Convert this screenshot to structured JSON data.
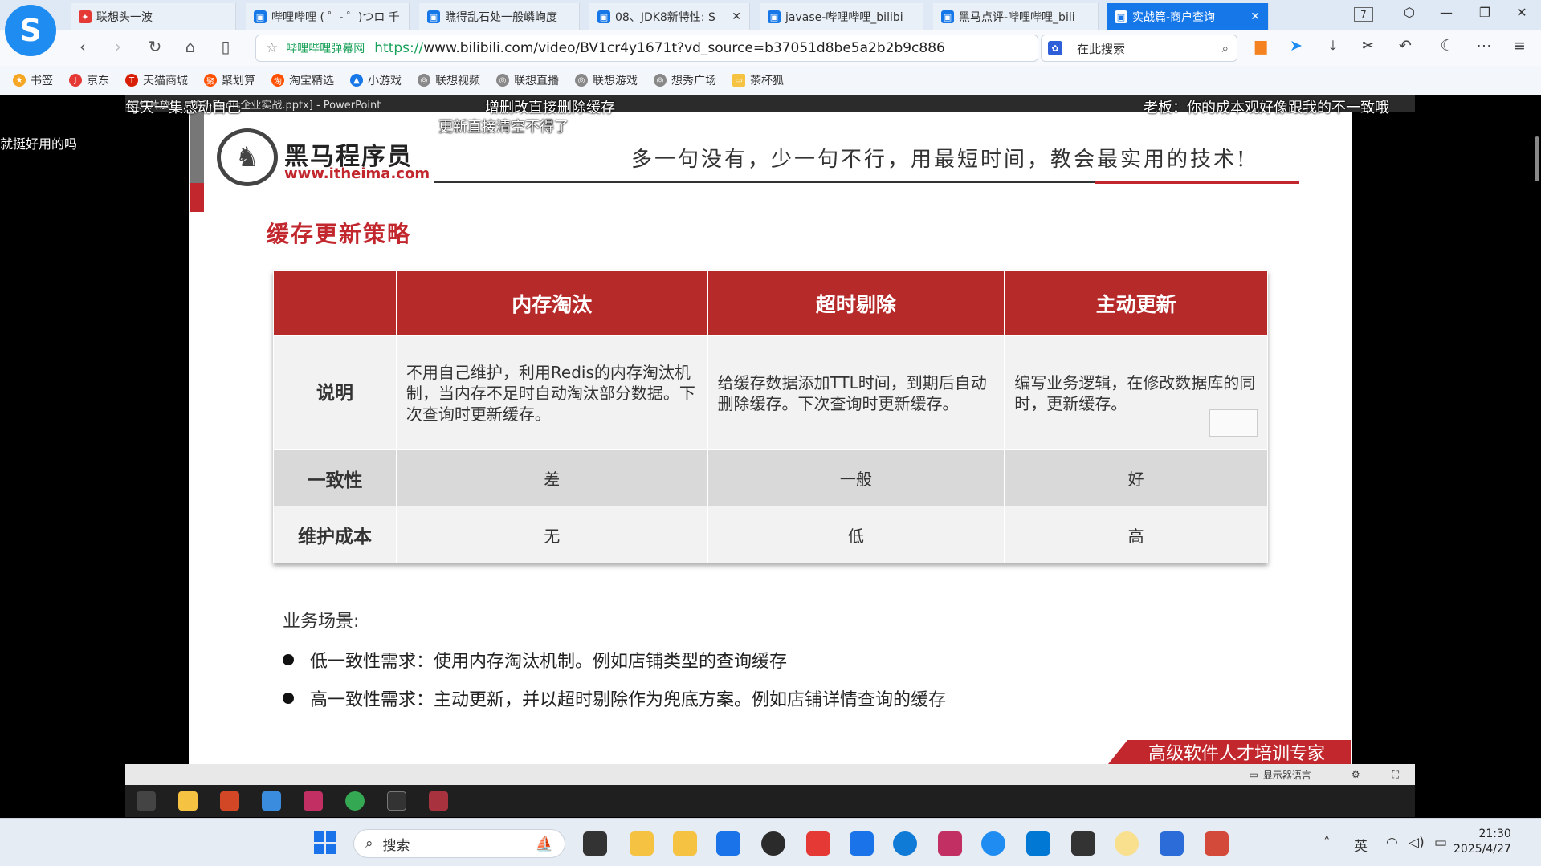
{
  "browser": {
    "tabs": [
      {
        "label": "联想头一波",
        "color": "#e53935",
        "icon": "lenovo-icon"
      },
      {
        "label": "哔哩哔哩 ( ゜- ゜)つロ 千",
        "color": "#1677e8",
        "icon": "bilibili-icon"
      },
      {
        "label": "瞧得乱石处一般嶙峋度",
        "color": "#1677e8",
        "icon": "bilibili-icon"
      },
      {
        "label": "08、JDK8新特性: S",
        "color": "#1677e8",
        "icon": "bilibili-icon"
      },
      {
        "label": "javase-哔哩哔哩_bilibi",
        "color": "#1677e8",
        "icon": "bilibili-icon"
      },
      {
        "label": "黑马点评-哔哩哔哩_bili",
        "color": "#1677e8",
        "icon": "bilibili-icon"
      },
      {
        "label": "实战篇-商户查询",
        "color": "#ffffff",
        "icon": "bilibili-icon",
        "active": true
      }
    ],
    "tab_count": "7",
    "address": {
      "site_label": "哔哩哔哩弹幕网",
      "https": "https://",
      "rest": "www.bilibili.com/video/BV1cr4y1671t?vd_source=b37051d8be5a2b2b9c886"
    },
    "search_placeholder": "在此搜索",
    "bookmarks": [
      {
        "label": "书签",
        "color": "#f5a623"
      },
      {
        "label": "京东",
        "color": "#e53935"
      },
      {
        "label": "天猫商城",
        "color": "#d81e06"
      },
      {
        "label": "聚划算",
        "color": "#ff5000"
      },
      {
        "label": "淘宝精选",
        "color": "#ff5000"
      },
      {
        "label": "小游戏",
        "color": "#1677e8"
      },
      {
        "label": "联想视频",
        "color": "#888888"
      },
      {
        "label": "联想直播",
        "color": "#888888"
      },
      {
        "label": "联想游戏",
        "color": "#888888"
      },
      {
        "label": "想秀广场",
        "color": "#888888"
      },
      {
        "label": "茶杯狐",
        "color": "#f5c242"
      }
    ]
  },
  "video": {
    "left_caption": "就挺好用的吗",
    "ppt_title": "幻灯片放映 - [02-Redis企业实战.pptx] - PowerPoint",
    "danmaku": [
      "每天一集感动自己",
      "增删改直接删除缓存",
      "更新直接清空不得了",
      "老板：你的成本观好像跟我的不一致哦"
    ],
    "control_label": "显示器语言"
  },
  "slide": {
    "brand_name": "黑马程序员",
    "brand_url": "www.itheima.com",
    "slogan": "多一句没有，少一句不行，用最短时间，教会最实用的技术!",
    "section_title": "缓存更新策略",
    "table": {
      "headers": [
        "",
        "内存淘汰",
        "超时剔除",
        "主动更新"
      ],
      "rows": [
        {
          "label": "说明",
          "cells": [
            "不用自己维护，利用Redis的内存淘汰机制，当内存不足时自动淘汰部分数据。下次查询时更新缓存。",
            "给缓存数据添加TTL时间，到期后自动删除缓存。下次查询时更新缓存。",
            "编写业务逻辑，在修改数据库的同时，更新缓存。"
          ]
        },
        {
          "label": "一致性",
          "cells": [
            "差",
            "一般",
            "好"
          ]
        },
        {
          "label": "维护成本",
          "cells": [
            "无",
            "低",
            "高"
          ]
        }
      ]
    },
    "business_label": "业务场景:",
    "bullets": [
      "低一致性需求：使用内存淘汰机制。例如店铺类型的查询缓存",
      "高一致性需求：主动更新，并以超时剔除作为兜底方案。例如店铺详情查询的缓存"
    ],
    "banner": "高级软件人才培训专家"
  },
  "taskbar": {
    "search_placeholder": "搜索",
    "ime": "英",
    "time": "21:30",
    "date": "2025/4/27"
  }
}
